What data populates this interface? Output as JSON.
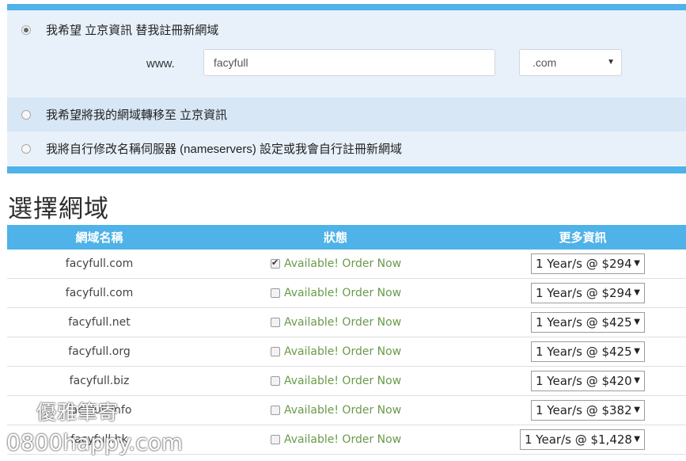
{
  "options": {
    "register_label": "我希望 立京資訊 替我註冊新網域",
    "transfer_label": "我希望將我的網域轉移至 立京資訊",
    "nameservers_label": "我將自行修改名稱伺服器 (nameservers) 設定或我會自行註冊新網域",
    "www_prefix": "www.",
    "domain_value": "facyfull",
    "tld_selected": ".com"
  },
  "section_title": "選擇網域",
  "table": {
    "headers": {
      "name": "網域名稱",
      "status": "狀態",
      "more": "更多資訊"
    },
    "rows": [
      {
        "domain": "facyfull.com",
        "checked": true,
        "status": "Available! Order Now",
        "price": "1 Year/s @ $294"
      },
      {
        "domain": "facyfull.com",
        "checked": false,
        "status": "Available! Order Now",
        "price": "1 Year/s @ $294"
      },
      {
        "domain": "facyfull.net",
        "checked": false,
        "status": "Available! Order Now",
        "price": "1 Year/s @ $425"
      },
      {
        "domain": "facyfull.org",
        "checked": false,
        "status": "Available! Order Now",
        "price": "1 Year/s @ $425"
      },
      {
        "domain": "facyfull.biz",
        "checked": false,
        "status": "Available! Order Now",
        "price": "1 Year/s @ $420"
      },
      {
        "domain": "facyfull.info",
        "checked": false,
        "status": "Available! Order Now",
        "price": "1 Year/s @ $382"
      },
      {
        "domain": "facyfull.hk",
        "checked": false,
        "status": "Available! Order Now",
        "price": "1 Year/s @ $1,428"
      }
    ]
  },
  "watermark": {
    "line1": "優雅筆寄",
    "line2": "0800happy.com"
  },
  "colors": {
    "accent": "#4fb2e8",
    "panel_bg": "#e8f1fa",
    "panel_alt": "#d8e7f5",
    "available_green": "#6a9a4a"
  }
}
